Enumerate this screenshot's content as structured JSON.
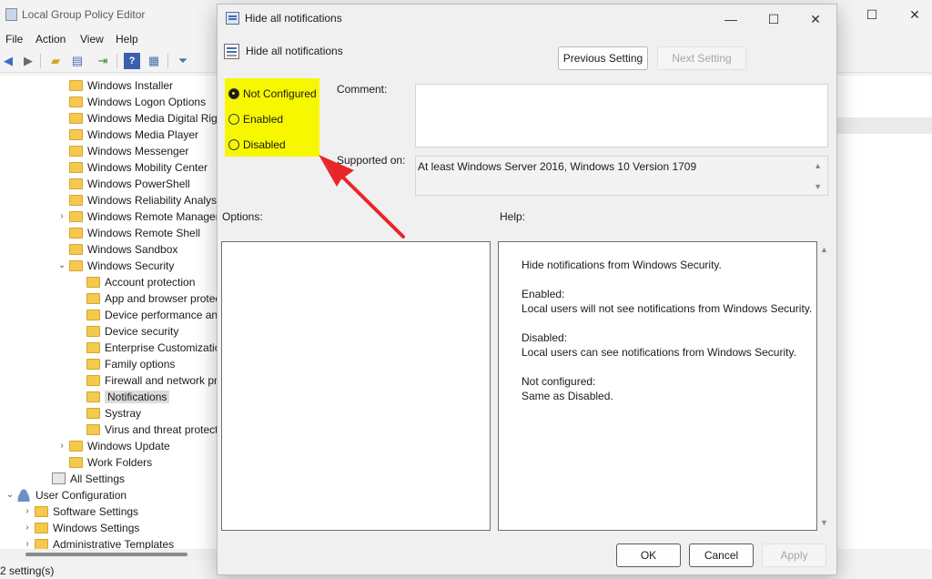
{
  "main": {
    "title": "Local Group Policy Editor",
    "menu": [
      "File",
      "Action",
      "View",
      "Help"
    ],
    "status": "2 setting(s)",
    "window_controls": {
      "minimize": "—",
      "maximize": "☐",
      "close": "✕"
    },
    "toolbar_icons": [
      "back-arrow-icon",
      "forward-arrow-icon",
      "up-folder-icon",
      "show-hide-tree-icon",
      "export-list-icon",
      "help-icon",
      "properties-icon",
      "filter-icon"
    ]
  },
  "tree": {
    "items": [
      {
        "label": "Windows Installer"
      },
      {
        "label": "Windows Logon Options"
      },
      {
        "label": "Windows Media Digital Righ"
      },
      {
        "label": "Windows Media Player"
      },
      {
        "label": "Windows Messenger"
      },
      {
        "label": "Windows Mobility Center"
      },
      {
        "label": "Windows PowerShell"
      },
      {
        "label": "Windows Reliability Analysis"
      },
      {
        "label": "Windows Remote Managem",
        "expander": "›"
      },
      {
        "label": "Windows Remote Shell"
      },
      {
        "label": "Windows Sandbox"
      },
      {
        "label": "Windows Security",
        "expander": "⌄"
      },
      {
        "label": "Account protection"
      },
      {
        "label": "App and browser protec"
      },
      {
        "label": "Device performance and"
      },
      {
        "label": "Device security"
      },
      {
        "label": "Enterprise Customization"
      },
      {
        "label": "Family options"
      },
      {
        "label": "Firewall and network pro"
      },
      {
        "label": "Notifications"
      },
      {
        "label": "Systray"
      },
      {
        "label": "Virus and threat protecti"
      },
      {
        "label": "Windows Update",
        "expander": "›"
      },
      {
        "label": "Work Folders"
      },
      {
        "label": "All Settings"
      },
      {
        "label": "User Configuration",
        "expander": "⌄"
      },
      {
        "label": "Software Settings",
        "expander": "›"
      },
      {
        "label": "Windows Settings",
        "expander": "›"
      },
      {
        "label": "Administrative Templates",
        "expander": "›"
      }
    ]
  },
  "dialog": {
    "title": "Hide all notifications",
    "policy_name": "Hide all notifications",
    "window_controls": {
      "minimize": "—",
      "maximize": "☐",
      "close": "✕"
    },
    "prev_button": "Previous Setting",
    "next_button": "Next Setting",
    "radios": [
      {
        "label": "Not Configured",
        "checked": true
      },
      {
        "label": "Enabled",
        "checked": false
      },
      {
        "label": "Disabled",
        "checked": false
      }
    ],
    "comment_label": "Comment:",
    "comment_value": "",
    "supported_label": "Supported on:",
    "supported_value": "At least Windows Server 2016, Windows 10 Version 1709",
    "options_label": "Options:",
    "help_label": "Help:",
    "help": {
      "p1": "Hide notifications from Windows Security.",
      "enabled_h": "Enabled:",
      "enabled_t": "Local users will not see notifications from Windows Security.",
      "disabled_h": "Disabled:",
      "disabled_t": "Local users can see notifications from Windows Security.",
      "nc_h": "Not configured:",
      "nc_t": "Same as Disabled."
    },
    "ok_button": "OK",
    "cancel_button": "Cancel",
    "apply_button": "Apply",
    "highlight_color": "#f7f700",
    "arrow_color": "#e8262a"
  }
}
